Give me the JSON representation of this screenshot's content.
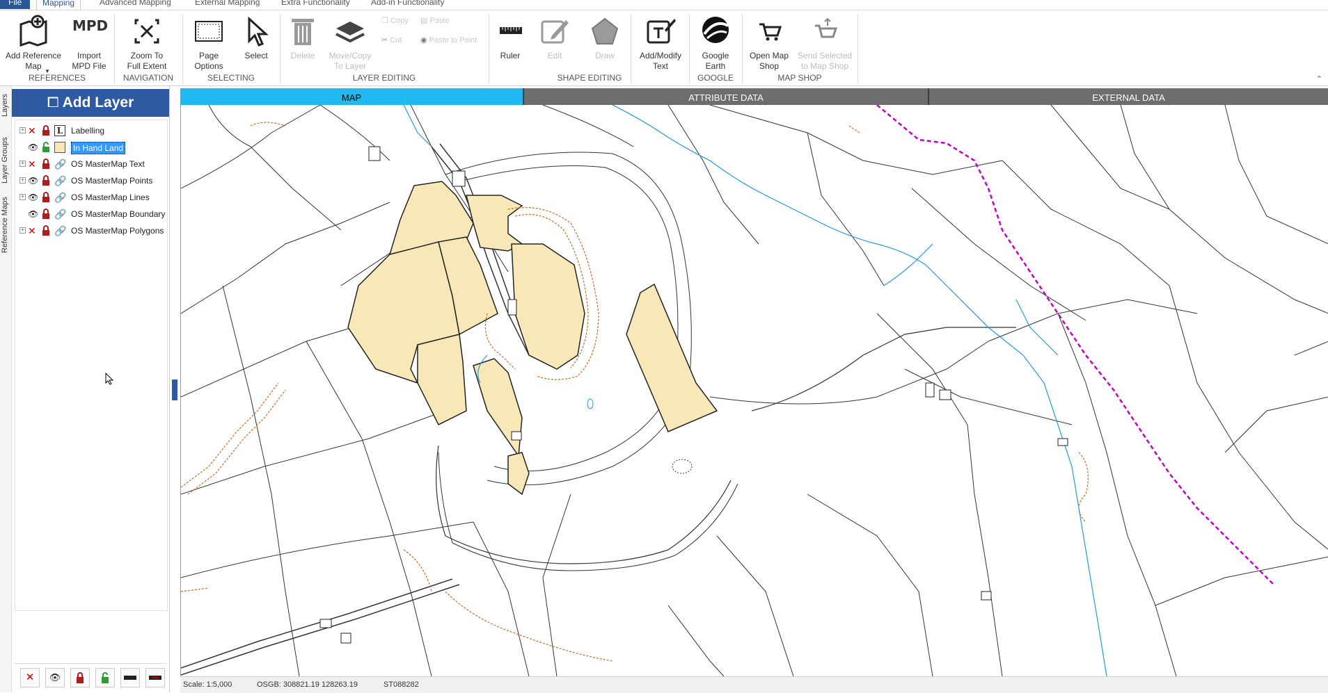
{
  "ribbon_tabs": [
    "File",
    "Mapping",
    "Advanced Mapping",
    "External Mapping",
    "Extra Functionality",
    "Add-in Functionality"
  ],
  "ribbon": {
    "add_reference_map": "Add Reference\nMap",
    "import_mpd": "Import\nMPD File",
    "mpd_icon_text": "MPD",
    "zoom_full_extent": "Zoom To\nFull Extent",
    "page_options": "Page\nOptions",
    "select": "Select",
    "delete": "Delete",
    "move_copy": "Move/Copy\nTo Layer",
    "copy": "Copy",
    "paste": "Paste",
    "cut": "Cut",
    "paste_to_point": "Paste to Point",
    "ruler": "Ruler",
    "edit": "Edit",
    "draw": "Draw",
    "add_modify_text": "Add/Modify\nText",
    "google_earth": "Google\nEarth",
    "open_map_shop": "Open Map\nShop",
    "send_to_map_shop": "Send Selected\nto Map Shop",
    "groups": {
      "references": "REFERENCES",
      "navigation": "NAVIGATION",
      "selecting": "SELECTING",
      "layer_editing": "LAYER EDITING",
      "shape_editing": "SHAPE EDITING",
      "google": "GOOGLE",
      "map_shop": "MAP SHOP"
    }
  },
  "side_tabs": [
    "Layers",
    "Layer Groups",
    "Reference Maps"
  ],
  "layer_panel": {
    "add_layer": "Add Layer",
    "layers": [
      {
        "name": "Labelling",
        "visible": false,
        "locked": true,
        "type": "label"
      },
      {
        "name": "In Hand Land",
        "visible": true,
        "locked": false,
        "type": "polygon",
        "selected": true
      },
      {
        "name": "OS MasterMap Text",
        "visible": false,
        "locked": true,
        "type": "link"
      },
      {
        "name": "OS MasterMap Points",
        "visible": true,
        "locked": true,
        "type": "link"
      },
      {
        "name": "OS MasterMap Lines",
        "visible": true,
        "locked": true,
        "type": "link"
      },
      {
        "name": "OS MasterMap Boundary",
        "visible": true,
        "locked": true,
        "type": "link"
      },
      {
        "name": "OS MasterMap Polygons",
        "visible": false,
        "locked": true,
        "type": "link"
      }
    ]
  },
  "map_tabs": [
    "MAP",
    "ATTRIBUTE DATA",
    "EXTERNAL DATA"
  ],
  "status_bar": {
    "scale": "Scale: 1:5,000",
    "osgb": "OSGB: 308821.19  128263.19",
    "grid_ref": "ST088282"
  },
  "colors": {
    "accent": "#2d5aa0",
    "active_tab": "#1fb8f0",
    "in_hand_fill": "#f8e8b8",
    "boundary_purple": "#c400c4",
    "water": "#1e9be0",
    "bank_orange": "#d2691e"
  }
}
